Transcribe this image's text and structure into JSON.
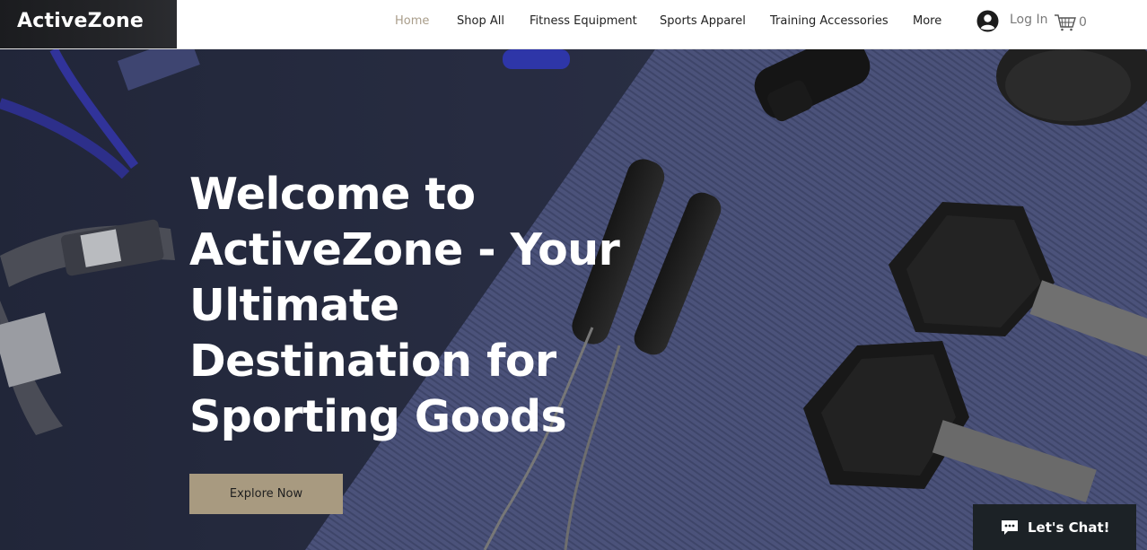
{
  "brand": {
    "name": "ActiveZone"
  },
  "nav": {
    "items": [
      {
        "label": "Home",
        "active": true
      },
      {
        "label": "Shop All",
        "active": false
      },
      {
        "label": "Fitness Equipment",
        "active": false
      },
      {
        "label": "Sports Apparel",
        "active": false
      },
      {
        "label": "Training Accessories",
        "active": false
      },
      {
        "label": "More",
        "active": false
      }
    ]
  },
  "account": {
    "login_label": "Log In",
    "user_icon": "user-avatar-icon"
  },
  "cart": {
    "count": "0",
    "icon": "shopping-basket-icon"
  },
  "hero": {
    "title": "Welcome to ActiveZone - Your Ultimate Destination for Sporting Goods",
    "cta_label": "Explore Now"
  },
  "chat": {
    "label": "Let's Chat!",
    "icon": "chat-bubble-icon"
  },
  "colors": {
    "accent": "#a99d8a",
    "button": "#a89a80",
    "hero_bg": "#2b3046",
    "logo_bg": "#232427",
    "chat_bg": "#1c2226"
  }
}
